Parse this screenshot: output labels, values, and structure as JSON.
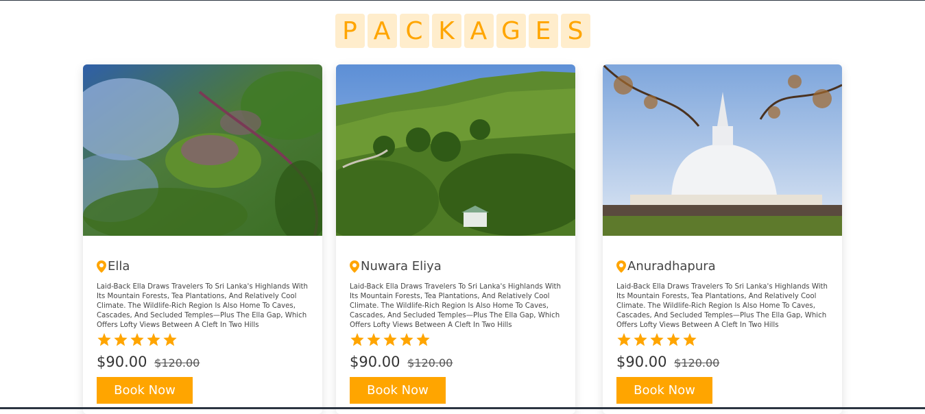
{
  "heading": {
    "letters": [
      "P",
      "A",
      "C",
      "K",
      "A",
      "G",
      "E",
      "S"
    ]
  },
  "colors": {
    "accent": "#ffa500",
    "letter_bg": "#ffedcc"
  },
  "cards": [
    {
      "location": "Ella",
      "description": "Laid-Back Ella Draws Travelers To Sri Lanka's Highlands With Its Mountain Forests, Tea Plantations, And Relatively Cool Climate. The Wildlife-Rich Region Is Also Home To Caves, Cascades, And Secluded Temples—Plus The Ella Gap, Which Offers Lofty Views Between A Cleft In Two Hills",
      "rating": 5,
      "price": "$90.00",
      "old_price": "$120.00",
      "button": "Book Now",
      "image_icon": "aerial-forest-railway"
    },
    {
      "location": "Nuwara Eliya",
      "description": "Laid-Back Ella Draws Travelers To Sri Lanka's Highlands With Its Mountain Forests, Tea Plantations, And Relatively Cool Climate. The Wildlife-Rich Region Is Also Home To Caves, Cascades, And Secluded Temples—Plus The Ella Gap, Which Offers Lofty Views Between A Cleft In Two Hills",
      "rating": 5,
      "price": "$90.00",
      "old_price": "$120.00",
      "button": "Book Now",
      "image_icon": "tea-plantation-hills"
    },
    {
      "location": "Anuradhapura",
      "description": "Laid-Back Ella Draws Travelers To Sri Lanka's Highlands With Its Mountain Forests, Tea Plantations, And Relatively Cool Climate. The Wildlife-Rich Region Is Also Home To Caves, Cascades, And Secluded Temples—Plus The Ella Gap, Which Offers Lofty Views Between A Cleft In Two Hills",
      "rating": 5,
      "price": "$90.00",
      "old_price": "$120.00",
      "button": "Book Now",
      "image_icon": "white-stupa-temple"
    }
  ]
}
